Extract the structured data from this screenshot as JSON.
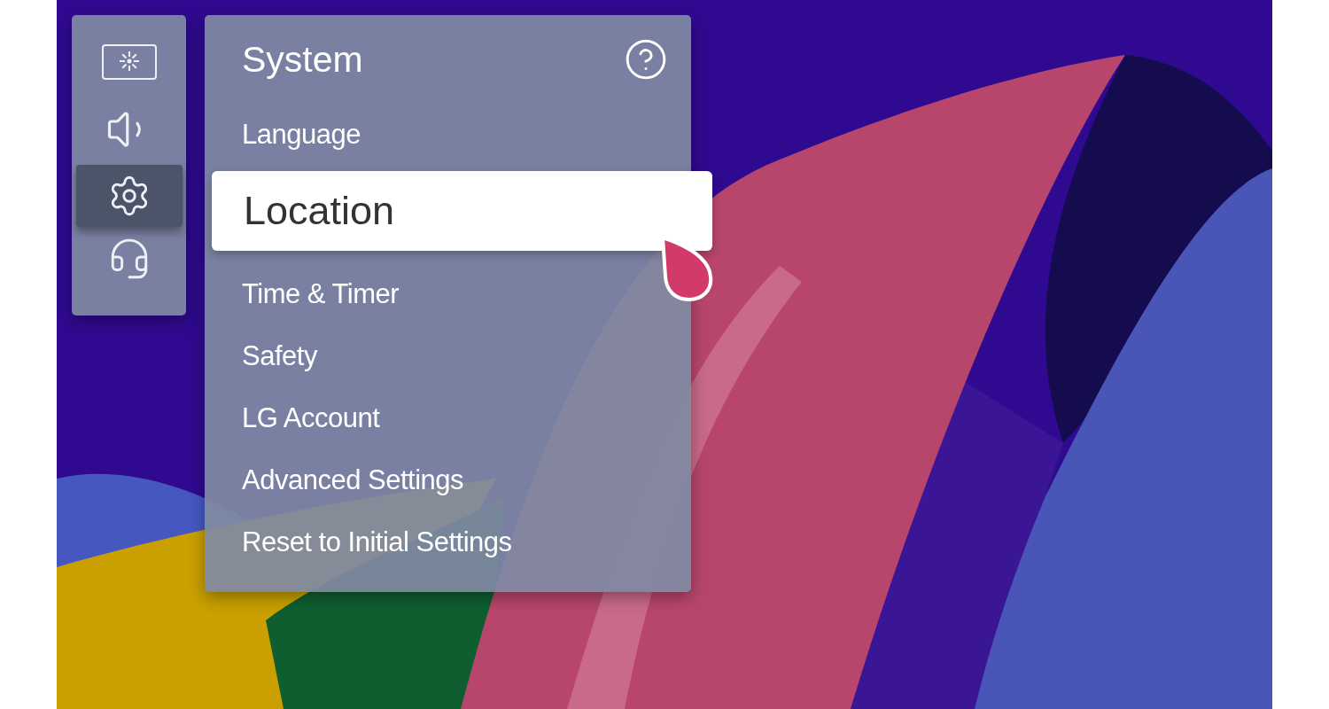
{
  "sidebar": {
    "items": [
      {
        "selected": false
      },
      {
        "selected": false
      },
      {
        "selected": true
      },
      {
        "selected": false
      }
    ]
  },
  "menu": {
    "title": "System",
    "items": [
      {
        "label": "Language",
        "selected": false
      },
      {
        "label": "Location",
        "selected": true
      },
      {
        "label": "Time & Timer",
        "selected": false
      },
      {
        "label": "Safety",
        "selected": false
      },
      {
        "label": "LG Account",
        "selected": false
      },
      {
        "label": "Advanced Settings",
        "selected": false
      },
      {
        "label": "Reset to Initial Settings",
        "selected": false
      }
    ]
  }
}
